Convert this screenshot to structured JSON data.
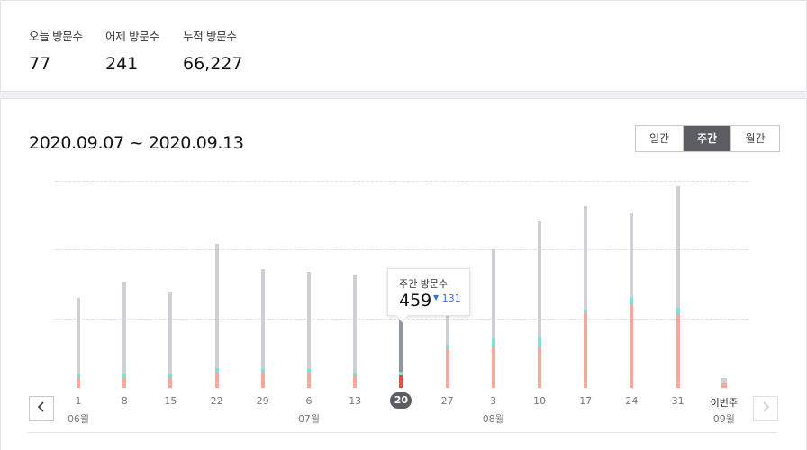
{
  "stats": [
    {
      "label": "오늘 방문수",
      "value": "77"
    },
    {
      "label": "어제 방문수",
      "value": "241"
    },
    {
      "label": "누적 방문수",
      "value": "66,227"
    }
  ],
  "chart": {
    "date_range": "2020.09.07 ~ 2020.09.13",
    "tabs": [
      {
        "label": "일간",
        "active": false
      },
      {
        "label": "주간",
        "active": true
      },
      {
        "label": "월간",
        "active": false
      }
    ],
    "tooltip": {
      "label": "주간 방문수",
      "value": "459",
      "delta_icon": "caret-down-icon",
      "delta": "131"
    },
    "nav": {
      "prev_icon": "chevron-left-icon",
      "next_icon": "chevron-right-icon"
    }
  },
  "chart_data": {
    "type": "bar",
    "stacked": true,
    "grid": true,
    "y_hidden": true,
    "categories": [
      "1",
      "8",
      "15",
      "22",
      "29",
      "6",
      "13",
      "20",
      "27",
      "3",
      "10",
      "17",
      "24",
      "31",
      "이번주"
    ],
    "month_labels": [
      {
        "index": 0,
        "label": "06월"
      },
      {
        "index": 5,
        "label": "07월"
      },
      {
        "index": 9,
        "label": "08월"
      },
      {
        "index": 14,
        "label": "09월"
      }
    ],
    "selected_index": 7,
    "series": [
      {
        "values": [
          60,
          60,
          65,
          90,
          90,
          90,
          75,
          73,
          230,
          240,
          240,
          430,
          485,
          425,
          30
        ]
      },
      {
        "values": [
          20,
          25,
          15,
          25,
          20,
          20,
          15,
          20,
          20,
          45,
          55,
          25,
          35,
          40,
          0
        ]
      },
      {
        "values": [
          440,
          530,
          480,
          720,
          580,
          560,
          560,
          366,
          330,
          520,
          670,
          600,
          490,
          700,
          25
        ]
      }
    ],
    "colors": {
      "bottom": "#f7a89c",
      "middle": "#7ddfd6",
      "top": "#cdd1d5",
      "selected_bottom": "#ee4b3e",
      "selected_middle": "#7ddfd6",
      "selected_top": "#8e959c"
    },
    "ylim": [
      0,
      1600
    ]
  }
}
